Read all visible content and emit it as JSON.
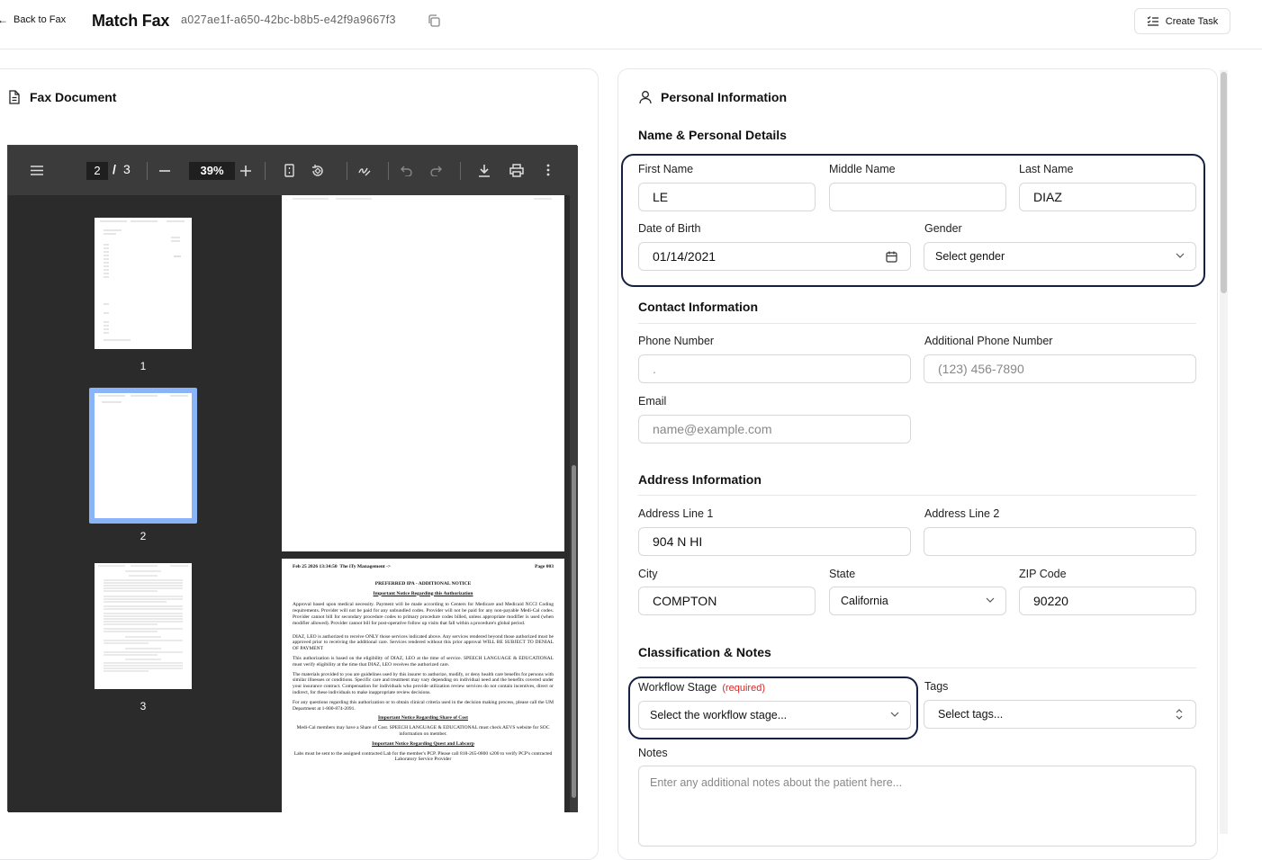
{
  "header": {
    "back_label": "Back to Fax",
    "title": "Match Fax",
    "fax_id": "a027ae1f-a650-42bc-b8b5-e42f9a9667f3",
    "create_task_label": "Create Task"
  },
  "left_panel": {
    "title": "Fax Document",
    "viewer": {
      "current_page": "2",
      "page_separator": "/",
      "total_pages": "3",
      "zoom": "39%",
      "thumbnail_labels": [
        "1",
        "2",
        "3"
      ]
    },
    "page3": {
      "fax_header_left": "Feb 25 2026 13:34:50",
      "fax_header_mid": "The iTy Management ->",
      "fax_header_right": "Page 003",
      "heading": "PREFERRED IPA - ADDITIONAL NOTICE",
      "sub1": "Important Notice Regarding this Authorization",
      "p1": "Approval based upon medical necessity. Payment will be made according to Centers for Medicare and Medicaid NCCI Coding requirements. Provider will not be paid for any unbundled codes. Provider will not be paid for any non-payable Medi-Cal codes. Provider cannot bill for secondary procedure codes to primary procedure codes billed, unless appropriate modifier is used (when modifier allowed). Provider cannot bill for post-operative follow up visits that fall within a procedure's global period.",
      "p2": "DIAZ, LEO is authorized to receive ONLY those services indicated above. Any services rendered beyond those authorized must be approved prior to receiving the additional care. Services rendered without this prior approval WILL BE SUBJECT TO DENIAL OF PAYMENT",
      "p3": "This authorization is based on the eligibility of DIAZ, LEO at the time of service. SPEECH LANGUAGE & EDUCATIONAL must verify eligibility at the time that DIAZ, LEO receives the authorized care.",
      "p4": "The materials provided to you are guidelines used by this insurer to authorize, modify, or deny health care benefits for persons with similar illnesses or conditions. Specific care and treatment may vary depending on individual need and the benefits covered under your insurance contract. Compensation for individuals who provide utilization review services do not contain incentives, direct or indirect, for these individuals to make inappropriate review decisions.",
      "p5": "For any questions regarding this authorization or to obtain clinical criteria used in the decision making process, please call the UM Department at 1-800-874-2091.",
      "sub2": "Important Notice Regarding Share of Cost",
      "p6": "Medi-Cal members may have a Share of Cost. SPEECH LANGUAGE & EDUCATIONAL must check AEVS website for SOC information on member.",
      "sub3": "Important Notice Regarding Quest and Labcorp",
      "p7": "Labs must be sent to the assigned contracted Lab for the member's PCP. Please call 818-265-0800 x200 to verify PCP's contracted Laboratory Service Provider"
    }
  },
  "right_panel": {
    "title": "Personal Information",
    "name_section": "Name & Personal Details",
    "first_name": {
      "label": "First Name",
      "value": "LE"
    },
    "middle_name": {
      "label": "Middle Name",
      "value": ""
    },
    "last_name": {
      "label": "Last Name",
      "value": "DIAZ"
    },
    "dob": {
      "label": "Date of Birth",
      "value": "01/14/2021"
    },
    "gender": {
      "label": "Gender",
      "value": "Select gender"
    },
    "contact_section": "Contact Information",
    "phone": {
      "label": "Phone Number",
      "value": "."
    },
    "alt_phone": {
      "label": "Additional Phone Number",
      "placeholder": "(123) 456-7890"
    },
    "email": {
      "label": "Email",
      "placeholder": "name@example.com"
    },
    "address_section": "Address Information",
    "address1": {
      "label": "Address Line 1",
      "value": "904 N HI"
    },
    "address2": {
      "label": "Address Line 2",
      "value": ""
    },
    "city": {
      "label": "City",
      "value": "COMPTON"
    },
    "state": {
      "label": "State",
      "value": "California"
    },
    "zip": {
      "label": "ZIP Code",
      "value": "90220"
    },
    "class_section": "Classification & Notes",
    "workflow": {
      "label": "Workflow Stage",
      "required": "(required)",
      "value": "Select the workflow stage..."
    },
    "tags": {
      "label": "Tags",
      "value": "Select tags..."
    },
    "notes": {
      "label": "Notes",
      "placeholder": "Enter any additional notes about the patient here..."
    }
  }
}
